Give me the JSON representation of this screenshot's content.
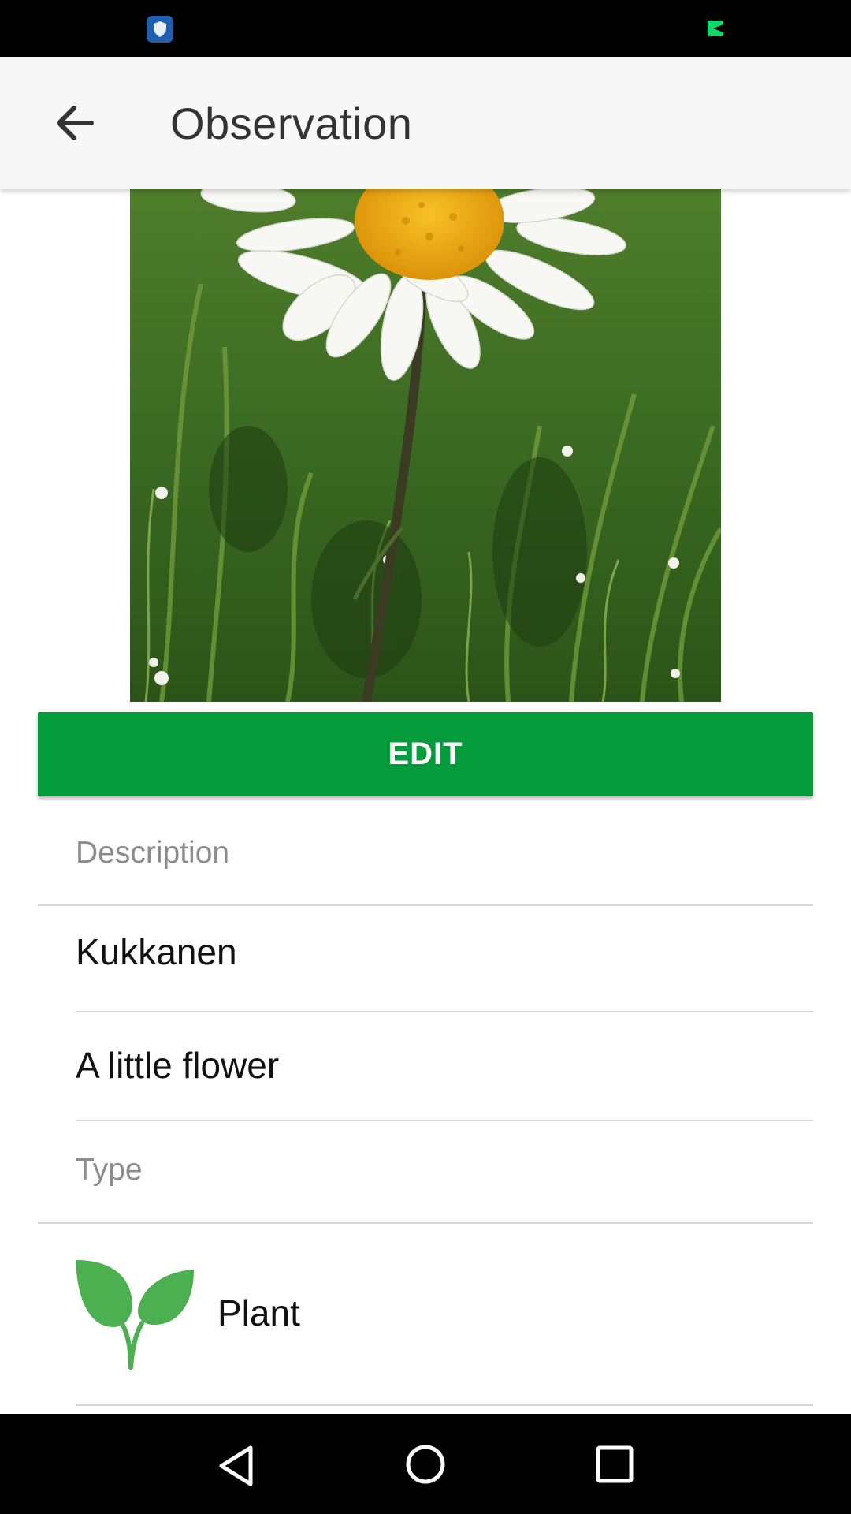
{
  "toolbar": {
    "title": "Observation",
    "back_icon": "arrow-left-icon"
  },
  "photo": {
    "description": "Daisy flower photo"
  },
  "edit_button": {
    "label": "EDIT",
    "color": "#049b3d"
  },
  "description_section": {
    "label": "Description",
    "fields": [
      "Kukkanen",
      "A little flower"
    ]
  },
  "type_section": {
    "label": "Type",
    "value": "Plant",
    "icon": "sprout-icon",
    "icon_color": "#4caf50"
  },
  "navbar": {
    "back_icon": "nav-back-icon",
    "home_icon": "nav-home-icon",
    "recents_icon": "nav-recents-icon"
  }
}
